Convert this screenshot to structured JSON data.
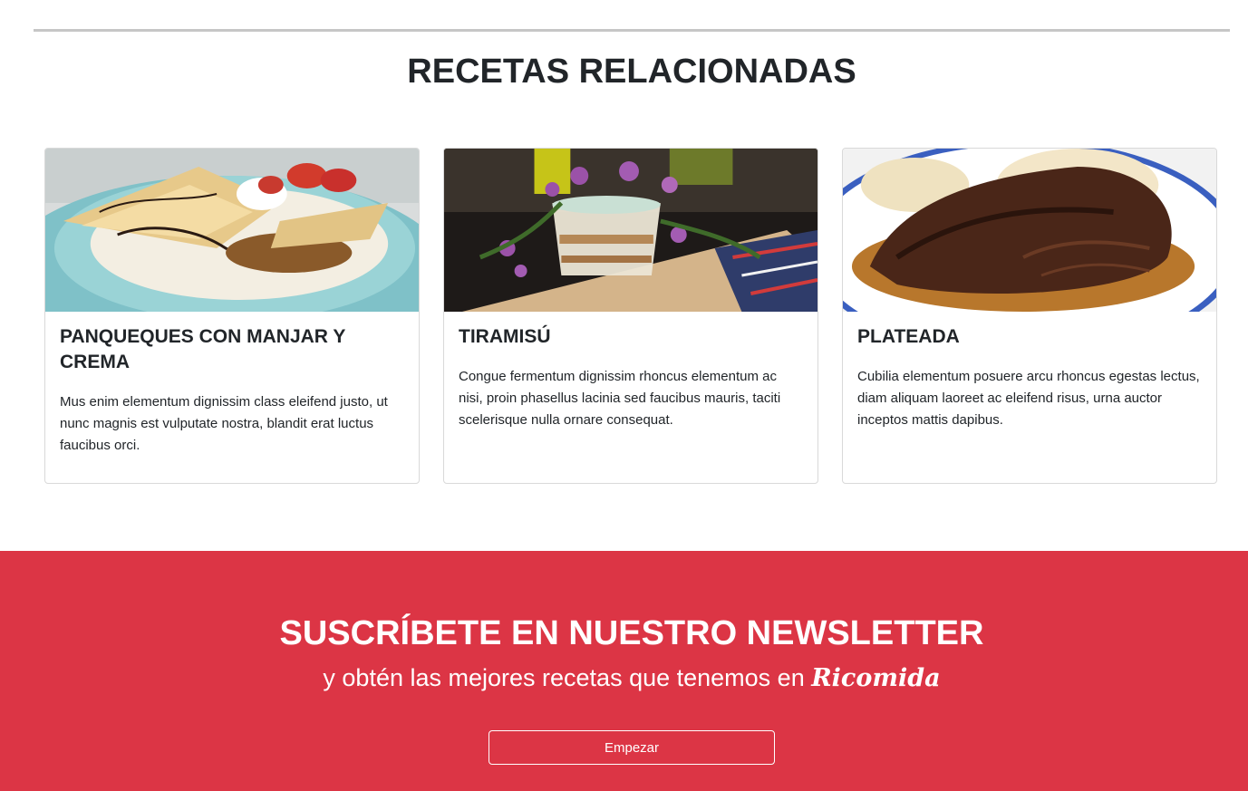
{
  "related": {
    "title": "RECETAS RELACIONADAS",
    "cards": [
      {
        "title": "PANQUEQUES CON MANJAR Y CREMA",
        "text": "Mus enim elementum dignissim class eleifend justo, ut nunc magnis est vulputate nostra, blandit erat luctus faucibus orci.",
        "image": "pancakes-photo"
      },
      {
        "title": "TIRAMISÚ",
        "text": "Congue fermentum dignissim rhoncus elementum ac nisi, proin phasellus lacinia sed faucibus mauris, taciti scelerisque nulla ornare consequat.",
        "image": "tiramisu-photo"
      },
      {
        "title": "PLATEADA",
        "text": "Cubilia elementum posuere arcu rhoncus egestas lectus, diam aliquam laoreet ac eleifend risus, urna auctor inceptos mattis dapibus.",
        "image": "plateada-photo"
      }
    ]
  },
  "newsletter": {
    "title": "SUSCRÍBETE EN NUESTRO NEWSLETTER",
    "subtitle": "y obtén las mejores recetas que tenemos en",
    "brand": "Ricomida",
    "button_label": "Empezar"
  },
  "colors": {
    "accent": "#dc3545",
    "divider": "#c6c6c6"
  }
}
